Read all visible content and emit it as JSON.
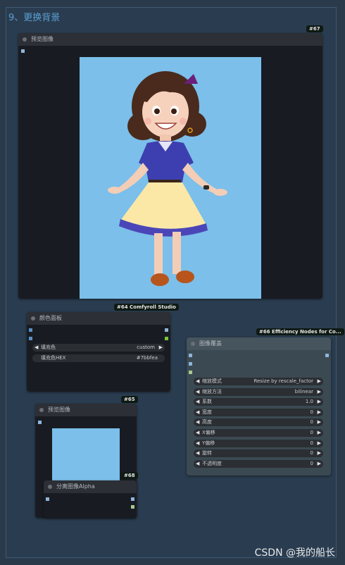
{
  "group": {
    "title": "9、更换背景"
  },
  "preview_node": {
    "badge": "#67",
    "title": "预览图像",
    "image_bg": "#7bbfea"
  },
  "color_panel_node": {
    "badge": "#64 Comfyroll Studio",
    "title": "颜色面板",
    "widgets": [
      {
        "label": "填充色",
        "value": "custom",
        "arrows": true
      },
      {
        "label": "填充色HEX",
        "value": "#7bbfea",
        "arrows": false
      }
    ]
  },
  "image_overlay_node": {
    "badge": "#66 Efficiency Nodes for Co...",
    "title": "图像覆盖",
    "widgets": [
      {
        "label": "缩放模式",
        "value": "Resize by rescale_factor"
      },
      {
        "label": "缩放方法",
        "value": "bilinear"
      },
      {
        "label": "系数",
        "value": "1.0"
      },
      {
        "label": "宽度",
        "value": "0"
      },
      {
        "label": "高度",
        "value": "0"
      },
      {
        "label": "X偏移",
        "value": "0"
      },
      {
        "label": "Y偏移",
        "value": "0"
      },
      {
        "label": "旋转",
        "value": "0"
      },
      {
        "label": "不透明度",
        "value": "0"
      }
    ]
  },
  "preview_node_2": {
    "badge": "#65",
    "title": "预览图像"
  },
  "alpha_node": {
    "badge": "#68",
    "title": "分离图像Alpha"
  },
  "watermark": "CSDN @我的船长"
}
